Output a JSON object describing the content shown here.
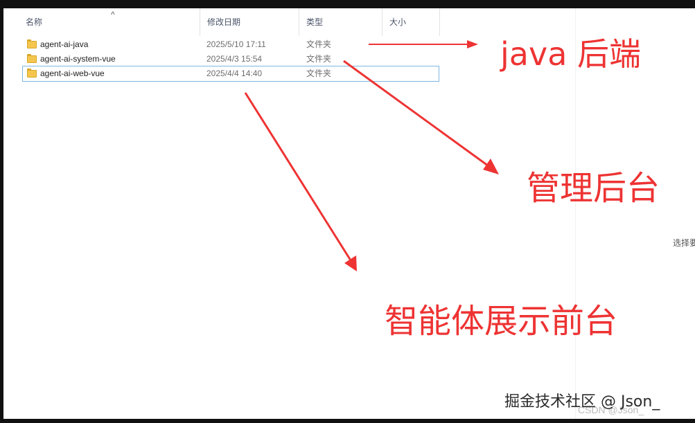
{
  "columns": {
    "name": "名称",
    "date": "修改日期",
    "type": "类型",
    "size": "大小",
    "sort_indicator": "^"
  },
  "files": [
    {
      "name": "agent-ai-java",
      "date": "2025/5/10 17:11",
      "type": "文件夹",
      "selected": false
    },
    {
      "name": "agent-ai-system-vue",
      "date": "2025/4/3 15:54",
      "type": "文件夹",
      "selected": false
    },
    {
      "name": "agent-ai-web-vue",
      "date": "2025/4/4 14:40",
      "type": "文件夹",
      "selected": true
    }
  ],
  "side_hint": "选择要",
  "annotations": {
    "java": "java 后端",
    "admin": "管理后台",
    "front": "智能体展示前台"
  },
  "annotation_color": "#ee3333",
  "folder_color": "#f5c64e",
  "watermark": {
    "main": "掘金技术社区 @ Json_",
    "csdn": "CSDN @Json_"
  }
}
